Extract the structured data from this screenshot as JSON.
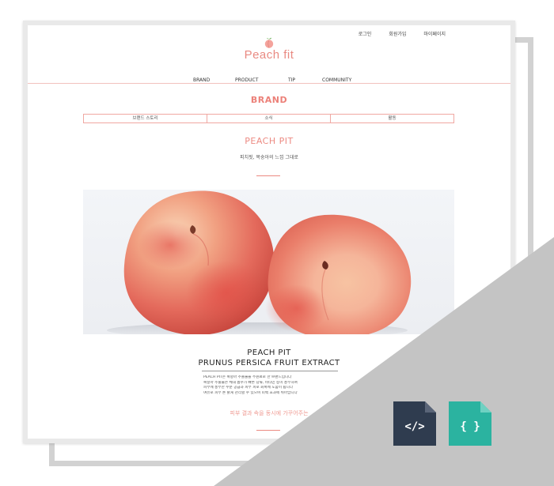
{
  "header": {
    "top_links": [
      "로그인",
      "회원가입",
      "마이페이지"
    ],
    "logo_text": "Peach fit",
    "nav": [
      "BRAND",
      "PRODUCT",
      "TIP",
      "COMMUNITY"
    ]
  },
  "section": {
    "title": "BRAND",
    "subtabs": [
      "브랜드 스토리",
      "소식",
      "활동"
    ]
  },
  "brand": {
    "name": "PEACH PIT",
    "tagline": "피치핏, 복숭아의 느낌 그대로"
  },
  "product": {
    "title_line1": "PEACH PIT",
    "title_line2": "PRUNUS PERSICA FRUIT EXTRACT",
    "description": [
      "PEACH PIT은 복숭아 추출물을 주원료로 한 브랜드입니다",
      "복숭아 추출물은 체내 흡수가 빠른 당류, 비타민 등이 풍부하여",
      "피부에 풍부한 수분 공급과 피부 피로 회복에 도움이 됩니다",
      "여유로 피부 톤 밝게 관리할 수 있으며 미백 효과에 뛰어납니다"
    ],
    "quote": "피부 결과 속을 동시에 가꾸어주는"
  },
  "icons": {
    "html_file": "html-file-icon",
    "json_file": "json-file-icon",
    "html_glyph": "</>",
    "json_glyph": "{ }"
  },
  "colors": {
    "accent": "#ec8a82",
    "overlay_gray": "#c4c4c4",
    "html_icon_bg": "#2f3c4f",
    "json_icon_bg": "#2bb3a0"
  }
}
